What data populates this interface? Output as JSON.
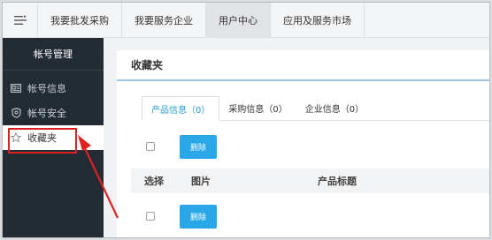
{
  "nav": {
    "items": [
      {
        "label": "我要批发采购",
        "active": false
      },
      {
        "label": "我要服务企业",
        "active": false
      },
      {
        "label": "用户中心",
        "active": true
      },
      {
        "label": "应用及服务市场",
        "active": false
      }
    ]
  },
  "sidebar": {
    "title": "帐号管理",
    "items": [
      {
        "label": "帐号信息",
        "icon": "id-card-icon",
        "active": false
      },
      {
        "label": "帐号安全",
        "icon": "shield-icon",
        "active": false
      },
      {
        "label": "收藏夹",
        "icon": "star-icon",
        "active": true
      }
    ]
  },
  "panel": {
    "title": "收藏夹",
    "tabs": [
      {
        "label": "产品信息（0）",
        "active": true
      },
      {
        "label": "采购信息（0）",
        "active": false
      },
      {
        "label": "企业信息（0）",
        "active": false
      }
    ],
    "delete_label": "删除",
    "table": {
      "columns": [
        "选择",
        "图片",
        "产品标题"
      ]
    }
  },
  "colors": {
    "sidebar_bg": "#232b34",
    "accent": "#2aa7e8",
    "annotation": "#e02020"
  }
}
